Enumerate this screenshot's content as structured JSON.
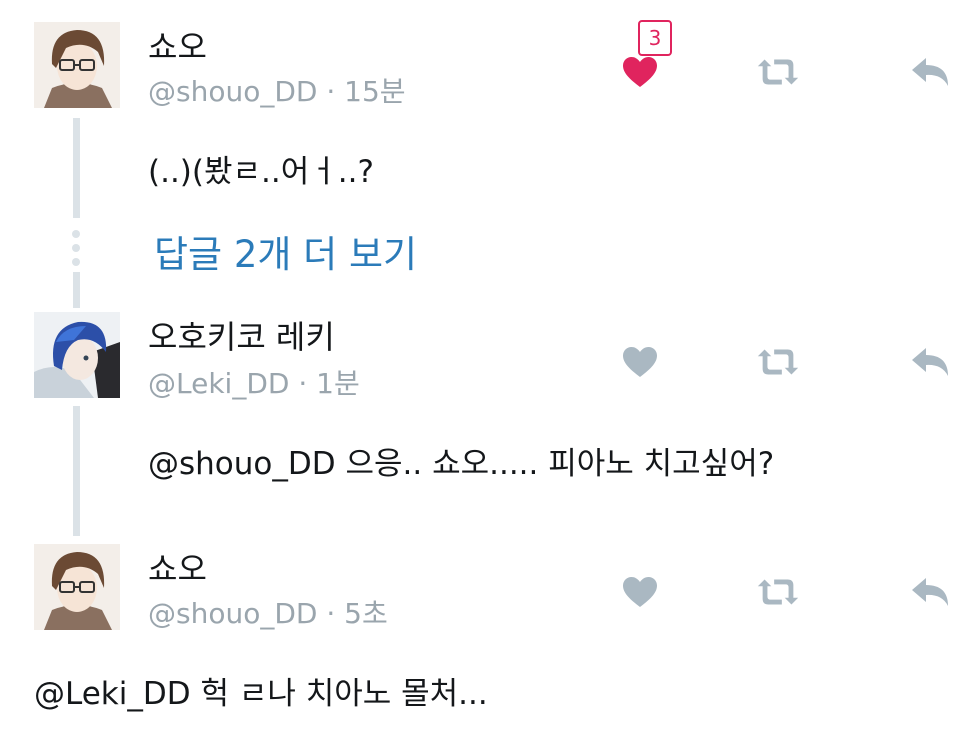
{
  "tweets": [
    {
      "display_name": "쇼오",
      "handle": "@shouo_DD",
      "time": "15분",
      "text": "(..)(봤ㄹ..어ㅓ..?",
      "liked": true,
      "like_count": "3"
    },
    {
      "display_name": "오호키코 레키",
      "handle": "@Leki_DD",
      "time": "1분",
      "text": "@shouo_DD 으응.. 쇼오..... 피아노 치고싶어?",
      "liked": false
    },
    {
      "display_name": "쇼오",
      "handle": "@shouo_DD",
      "time": "5초",
      "text": "@Leki_DD 헉 ㄹ나 치아노 몰처...",
      "liked": false
    }
  ],
  "thread": {
    "more_replies_label": "답글 2개 더 보기"
  },
  "separator": " · ",
  "colors": {
    "like_active": "#e0245e",
    "action_inactive": "#aab8c2",
    "link": "#2b7bb9",
    "thread_line": "#dbe2e7",
    "handle": "#9aa5ad"
  },
  "icons": [
    "heart-icon",
    "retweet-icon",
    "reply-icon"
  ]
}
